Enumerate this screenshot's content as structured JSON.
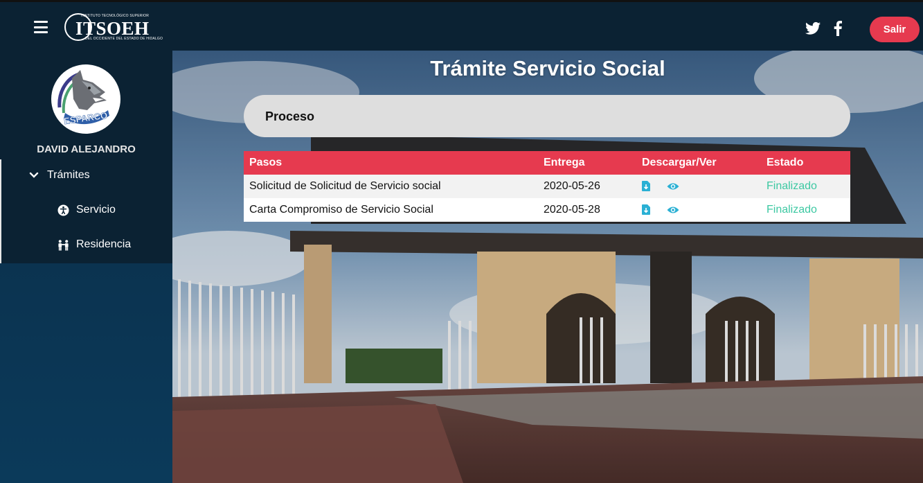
{
  "header": {
    "logo": {
      "name": "ITSOEH",
      "top_line": "INSTITUTO TECNOLÓGICO SUPERIOR",
      "bottom_line": "DEL OCCIDENTE DEL ESTADO DE HIDALGO"
    },
    "logout_label": "Salir",
    "icons": [
      "hamburger-icon",
      "twitter-icon",
      "facebook-icon"
    ]
  },
  "sidebar": {
    "avatar_text": "ESPARCO",
    "user_name": "DAVID ALEJANDRO",
    "menu": {
      "group_label": "Trámites",
      "items": [
        {
          "label": "Servicio",
          "icon": "accessibility-icon"
        },
        {
          "label": "Residencia",
          "icon": "people-icon"
        }
      ]
    }
  },
  "main": {
    "title": "Trámite Servicio Social",
    "section_label": "Proceso",
    "table": {
      "headers": [
        "Pasos",
        "Entrega",
        "Descargar/Ver",
        "Estado"
      ],
      "rows": [
        {
          "paso": "Solicitud de Solicitud de Servicio social",
          "entrega": "2020-05-26",
          "estado": "Finalizado"
        },
        {
          "paso": "Carta Compromiso de Servicio Social",
          "entrega": "2020-05-28",
          "estado": "Finalizado"
        }
      ]
    }
  },
  "colors": {
    "accent": "#e63a4f",
    "topbar": "#0b2233",
    "sidebar": "#0b2233",
    "status_done": "#3cc8a2",
    "action_icon": "#2ab0d4"
  }
}
